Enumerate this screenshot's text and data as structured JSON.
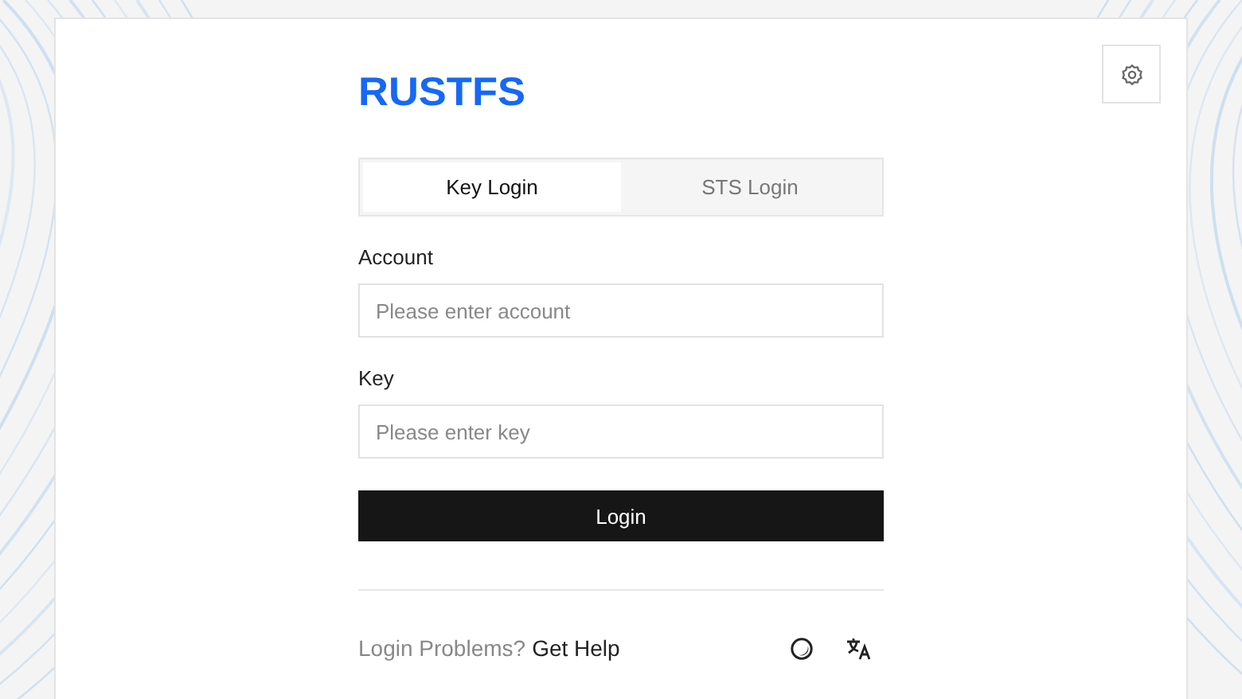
{
  "logo": "RUSTFS",
  "tabs": [
    {
      "label": "Key Login",
      "selected": true
    },
    {
      "label": "STS Login",
      "selected": false
    }
  ],
  "fields": [
    {
      "label": "Account",
      "placeholder": "Please enter account"
    },
    {
      "label": "Key",
      "placeholder": "Please enter key"
    }
  ],
  "submit": "Login",
  "footer": {
    "prompt": "Login Problems?",
    "link": "Get Help"
  }
}
